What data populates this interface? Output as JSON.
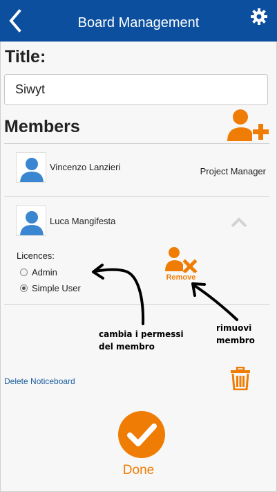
{
  "header": {
    "title": "Board Management",
    "back_icon": "back-chevron-icon",
    "settings_icon": "gear-icon"
  },
  "form": {
    "title_label": "Title:",
    "title_value": "Siwyt",
    "members_label": "Members"
  },
  "members": [
    {
      "name": "Vincenzo Lanzieri",
      "role": "Project Manager"
    },
    {
      "name": "Luca Mangifesta"
    }
  ],
  "licences": {
    "label": "Licences:",
    "options": [
      {
        "label": "Admin",
        "selected": false
      },
      {
        "label": "Simple User",
        "selected": true
      }
    ]
  },
  "remove": {
    "label": "Remove"
  },
  "annotations": {
    "permissions": [
      "cambia i permessi",
      "del membro"
    ],
    "remove": [
      "rimuovi",
      "membro"
    ]
  },
  "footer": {
    "delete_label": "Delete Noticeboard",
    "done_label": "Done"
  },
  "colors": {
    "header": "#0c4f9e",
    "accent": "#ef7d05",
    "avatar": "#3a86d1",
    "link": "#1a5d9e"
  }
}
